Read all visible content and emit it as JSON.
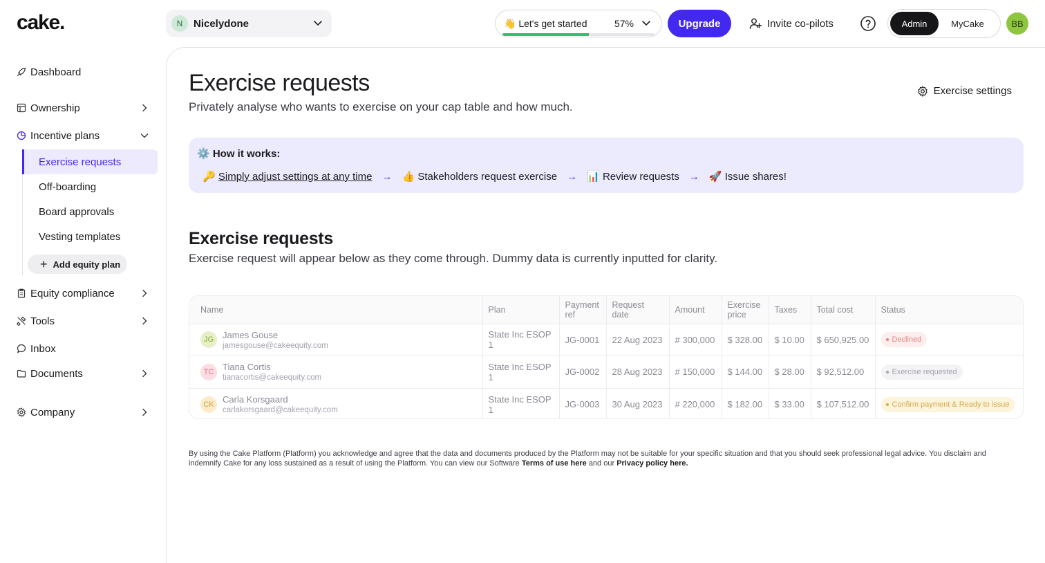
{
  "brand": {
    "logo_text": "cake.",
    "accent": "#4328f0"
  },
  "company": {
    "avatar_letter": "N",
    "name": "Nicelydone"
  },
  "onboarding": {
    "label": "👋 Let's get started",
    "percent_text": "57%",
    "progress": 0.57
  },
  "header": {
    "upgrade_label": "Upgrade",
    "invite_label": "Invite co-pilots",
    "help_icon": "help-circle-icon",
    "roles": {
      "active": "Admin",
      "inactive": "MyCake"
    },
    "user_initials": "BB"
  },
  "sidebar": {
    "dashboard": "Dashboard",
    "ownership": "Ownership",
    "incentive_plans": "Incentive plans",
    "sub": [
      "Exercise requests",
      "Off-boarding",
      "Board approvals",
      "Vesting templates"
    ],
    "add_equity_plan": "Add equity plan",
    "equity_compliance": "Equity compliance",
    "tools": "Tools",
    "inbox": "Inbox",
    "documents": "Documents",
    "company": "Company"
  },
  "page": {
    "title": "Exercise requests",
    "subtitle": "Privately analyse who wants to exercise on your cap table and how much.",
    "settings_label": "Exercise settings"
  },
  "how_it_works": {
    "title": "⚙️ How it works:",
    "steps": [
      {
        "emoji": "🔑",
        "text": "Simply adjust settings at any time"
      },
      {
        "emoji": "👍",
        "text": "Stakeholders request exercise"
      },
      {
        "emoji": "📊",
        "text": "Review requests"
      },
      {
        "emoji": "🚀",
        "text": "Issue shares!"
      }
    ],
    "arrow": "→"
  },
  "requests": {
    "title": "Exercise requests",
    "subtitle": "Exercise request will appear below as they come through. Dummy data is currently inputted for clarity.",
    "columns": [
      "Name",
      "Plan",
      "Payment ref",
      "Request date",
      "Amount",
      "Exercise price",
      "Taxes",
      "Total cost",
      "Status"
    ],
    "rows": [
      {
        "initials": "JG",
        "avatar_bg": "#e6f0c8",
        "avatar_fg": "#8aa83d",
        "name": "James Gouse",
        "email": "jamesgouse@cakeequity.com",
        "plan": "State Inc ESOP 1",
        "payment_ref": "JG-0001",
        "request_date": "22 Aug 2023",
        "amount": "# 300,000",
        "exercise_price": "$ 328.00",
        "taxes": "$ 10.00",
        "total_cost": "$ 650,925.00",
        "status": "Declined",
        "status_bg": "#fdeeee",
        "status_fg": "#e38383"
      },
      {
        "initials": "TC",
        "avatar_bg": "#fbdde2",
        "avatar_fg": "#d9788a",
        "name": "Tiana Cortis",
        "email": "tianacortis@cakeequity.com",
        "plan": "State Inc ESOP 1",
        "payment_ref": "JG-0002",
        "request_date": "28 Aug 2023",
        "amount": "# 150,000",
        "exercise_price": "$ 144.00",
        "taxes": "$ 28.00",
        "total_cost": "$ 92,512.00",
        "status": "Exercise requested",
        "status_bg": "#f3f3f5",
        "status_fg": "#a3a3ad"
      },
      {
        "initials": "CK",
        "avatar_bg": "#fcecc9",
        "avatar_fg": "#c9a04a",
        "name": "Carla Korsgaard",
        "email": "carlakorsgaard@cakeequity.com",
        "plan": "State Inc ESOP 1",
        "payment_ref": "JG-0003",
        "request_date": "30 Aug 2023",
        "amount": "# 220,000",
        "exercise_price": "$ 182.00",
        "taxes": "$ 33.00",
        "total_cost": "$ 107,512.00",
        "status": "Confirm payment & Ready to issue",
        "status_bg": "#fdf4dc",
        "status_fg": "#d6a84a"
      }
    ]
  },
  "disclaimer": {
    "text": "By using the Cake Platform (Platform) you acknowledge and agree that the data and documents produced by the Platform may not be suitable for your specific situation and that you should seek professional legal advice. You disclaim and indemnify Cake for any loss sustained as a result of using the Platform. You can view our Software ",
    "terms_link": "Terms of use here",
    "middle": " and our ",
    "privacy_link": "Privacy policy here."
  }
}
